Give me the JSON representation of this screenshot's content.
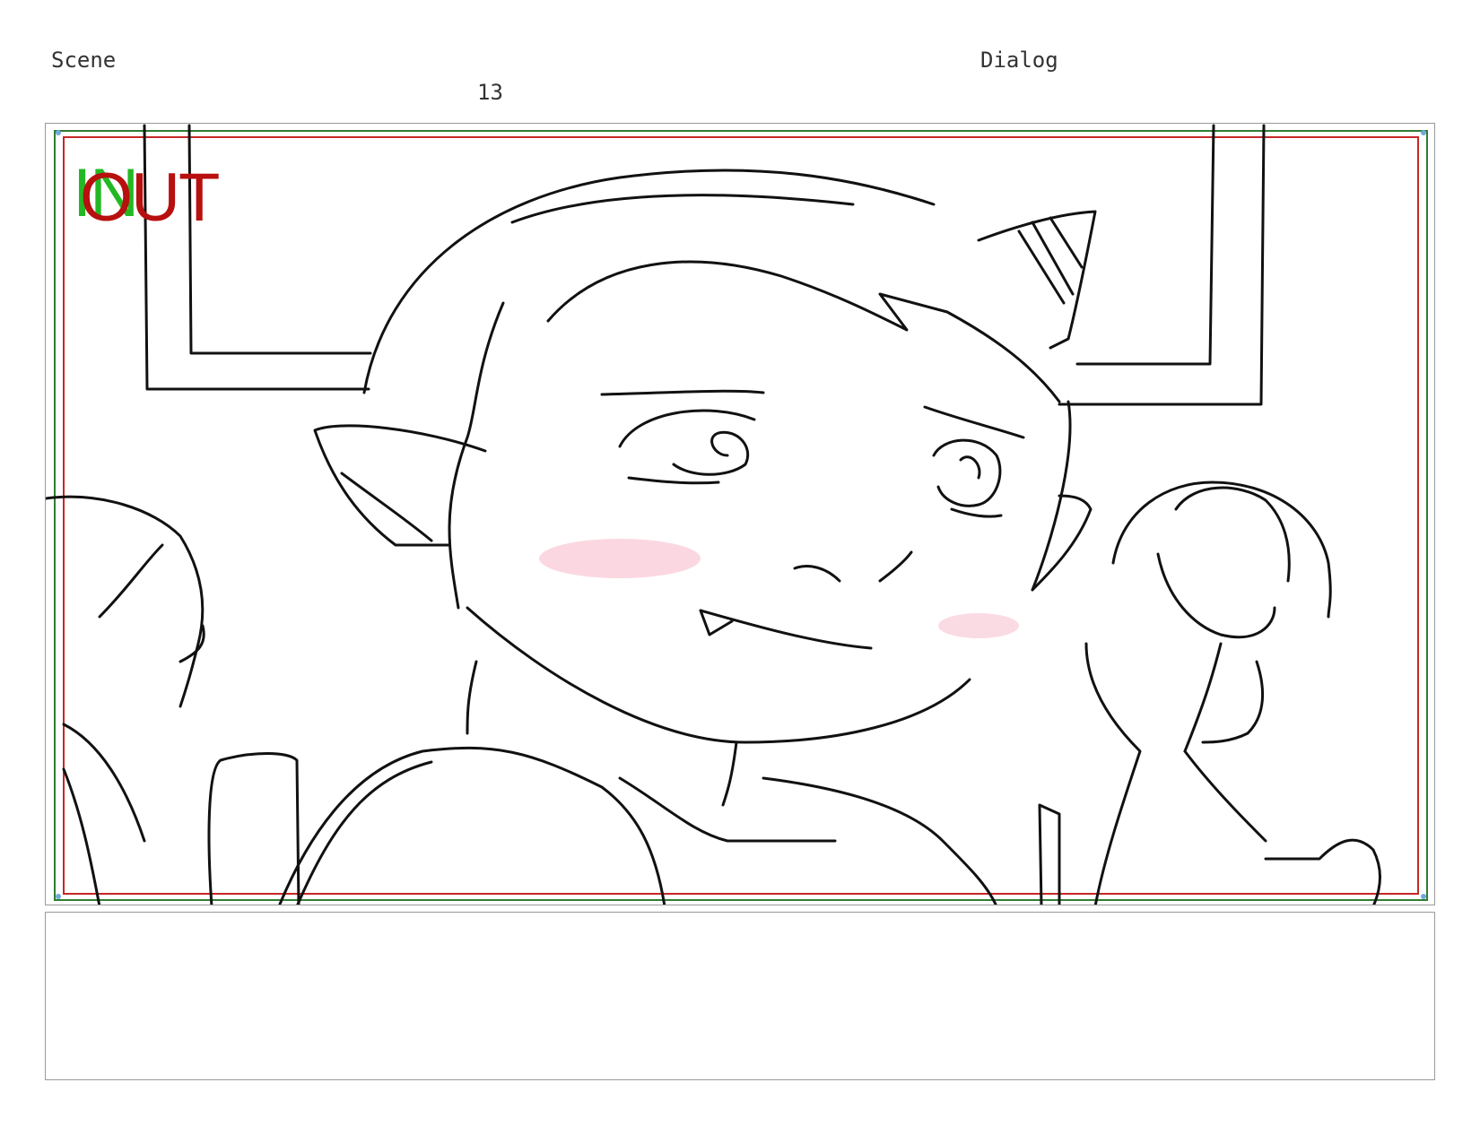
{
  "header": {
    "scene_label": "Scene",
    "scene_number": "13",
    "dialog_label": "Dialog"
  },
  "panel": {
    "in_marker": "IN",
    "out_marker": "OUT",
    "safe_frame_color": "#2e7d32",
    "action_frame_color": "#c62828",
    "in_color": "#23b823",
    "out_color": "#b80f0f",
    "sketch_subject": "storyboard-sketch"
  },
  "dialog": {
    "text": ""
  }
}
